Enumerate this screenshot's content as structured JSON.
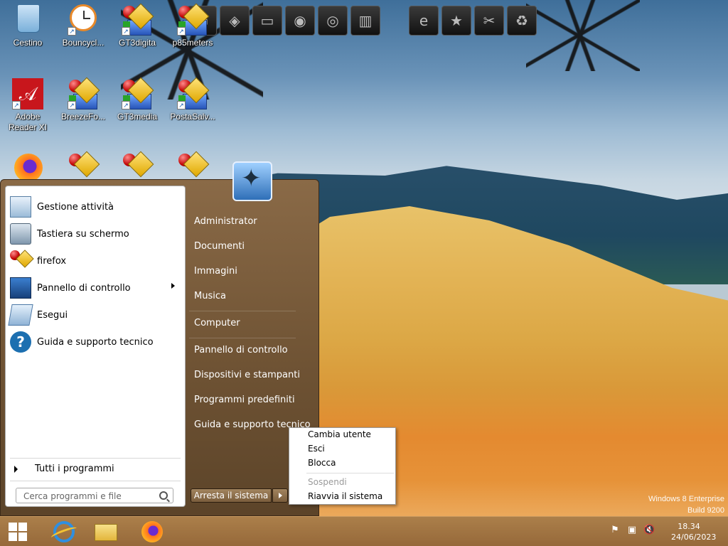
{
  "desktop": {
    "icons": [
      {
        "label": "Cestino",
        "icon": "recycle-bin-icon"
      },
      {
        "label": "Bouncycl...",
        "icon": "clock-icon"
      },
      {
        "label": "GT3digita",
        "icon": "network-app-icon"
      },
      {
        "label": "p85meters",
        "icon": "network-app-icon"
      },
      {
        "label": "Adobe Reader XI",
        "icon": "pdf-icon"
      },
      {
        "label": "BreezeFo...",
        "icon": "network-app-icon"
      },
      {
        "label": "GT3media",
        "icon": "network-app-icon"
      },
      {
        "label": "PostaSalv...",
        "icon": "network-app-icon"
      }
    ],
    "watermark_line1": "Windows 8 Enterprise",
    "watermark_line2": "Build 9200"
  },
  "start_menu": {
    "programs": [
      {
        "label": "Gestione attività",
        "icon": "task-manager-icon"
      },
      {
        "label": "Tastiera su schermo",
        "icon": "keyboard-icon"
      },
      {
        "label": "firefox",
        "icon": "network-app-icon"
      },
      {
        "label": "Pannello di controllo",
        "icon": "control-panel-icon"
      },
      {
        "label": "Esegui",
        "icon": "run-icon"
      },
      {
        "label": "Guida e supporto tecnico",
        "icon": "help-icon"
      }
    ],
    "all_programs": "Tutti i programmi",
    "search_placeholder": "Cerca programmi e file",
    "right_items": [
      "Administrator",
      "Documenti",
      "Immagini",
      "Musica",
      "Computer",
      "Pannello di controllo",
      "Dispositivi e stampanti",
      "Programmi predefiniti",
      "Guida e supporto tecnico"
    ],
    "shutdown_label": "Arresta il sistema",
    "shutdown_menu": [
      {
        "label": "Cambia utente",
        "enabled": true
      },
      {
        "label": "Esci",
        "enabled": true
      },
      {
        "label": "Blocca",
        "enabled": true
      },
      {
        "label": "Sospendi",
        "enabled": false
      },
      {
        "label": "Riavvia il sistema",
        "enabled": true
      }
    ]
  },
  "taskbar": {
    "pinned": [
      "start-windows-icon",
      "internet-explorer-icon",
      "file-explorer-icon",
      "firefox-icon"
    ],
    "time": "18.34",
    "date": "24/06/2023",
    "tray_icons": [
      "flag-icon",
      "network-icon",
      "volume-muted-icon"
    ]
  }
}
